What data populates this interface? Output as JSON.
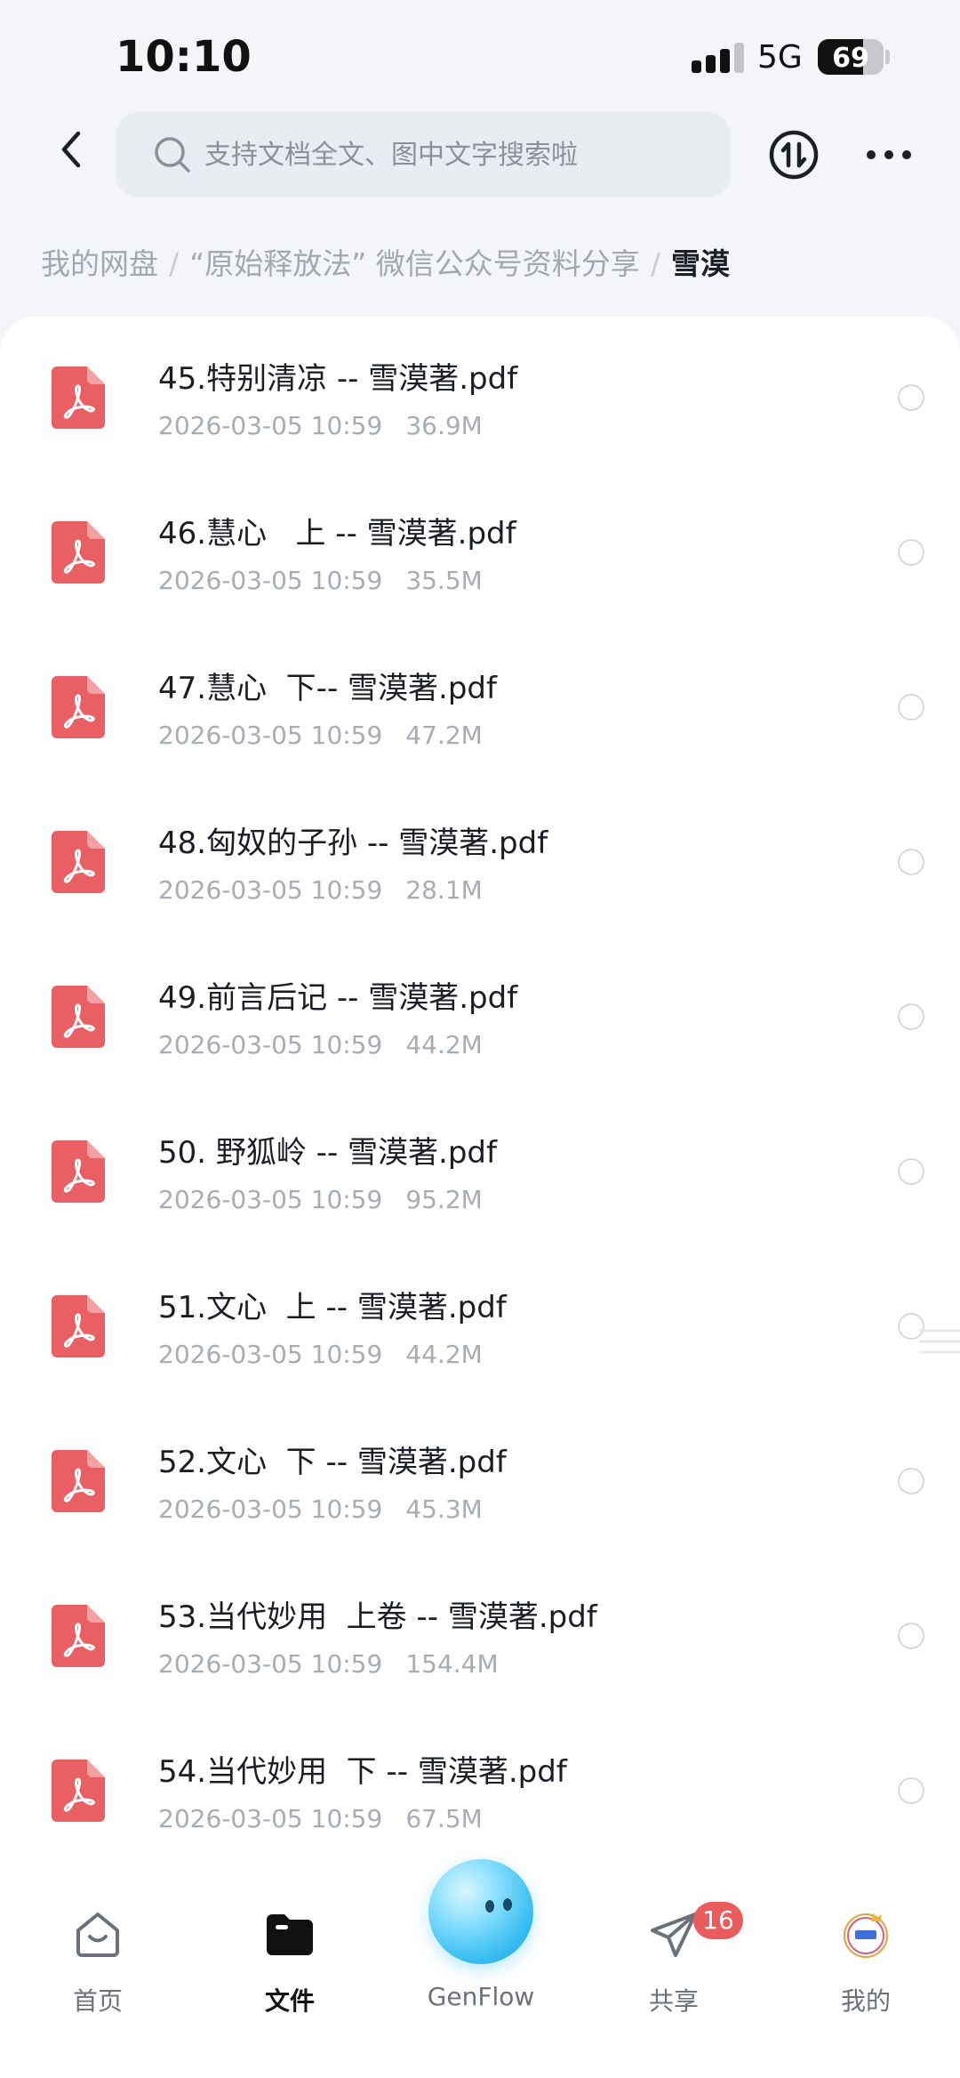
{
  "status_bar": {
    "time": "10:10",
    "network": "5G",
    "battery": "69"
  },
  "search": {
    "placeholder": "支持文档全文、图中文字搜索啦"
  },
  "breadcrumb": {
    "items": [
      "我的网盘",
      "“原始释放法” 微信公众号资料分享"
    ],
    "current": "雪漠"
  },
  "files": [
    {
      "name": "45.特别清凉 -- 雪漠著.pdf",
      "date": "2026-03-05 10:59",
      "size": "36.9M"
    },
    {
      "name": "46.慧心   上 -- 雪漠著.pdf",
      "date": "2026-03-05 10:59",
      "size": "35.5M"
    },
    {
      "name": "47.慧心  下-- 雪漠著.pdf",
      "date": "2026-03-05 10:59",
      "size": "47.2M"
    },
    {
      "name": "48.匈奴的子孙 -- 雪漠著.pdf",
      "date": "2026-03-05 10:59",
      "size": "28.1M"
    },
    {
      "name": "49.前言后记 -- 雪漠著.pdf",
      "date": "2026-03-05 10:59",
      "size": "44.2M"
    },
    {
      "name": "50. 野狐岭 -- 雪漠著.pdf",
      "date": "2026-03-05 10:59",
      "size": "95.2M"
    },
    {
      "name": "51.文心  上 -- 雪漠著.pdf",
      "date": "2026-03-05 10:59",
      "size": "44.2M"
    },
    {
      "name": "52.文心  下 -- 雪漠著.pdf",
      "date": "2026-03-05 10:59",
      "size": "45.3M"
    },
    {
      "name": "53.当代妙用  上卷 -- 雪漠著.pdf",
      "date": "2026-03-05 10:59",
      "size": "154.4M"
    },
    {
      "name": "54.当代妙用  下 -- 雪漠著.pdf",
      "date": "2026-03-05 10:59",
      "size": "67.5M"
    }
  ],
  "nav": {
    "home": "首页",
    "files": "文件",
    "genflow": "GenFlow",
    "share": "共享",
    "share_badge": "16",
    "mine": "我的"
  },
  "colors": {
    "pdf_red": "#ea5f63",
    "badge_red": "#ea5b5b",
    "accent_blue": "#38bdf0"
  }
}
